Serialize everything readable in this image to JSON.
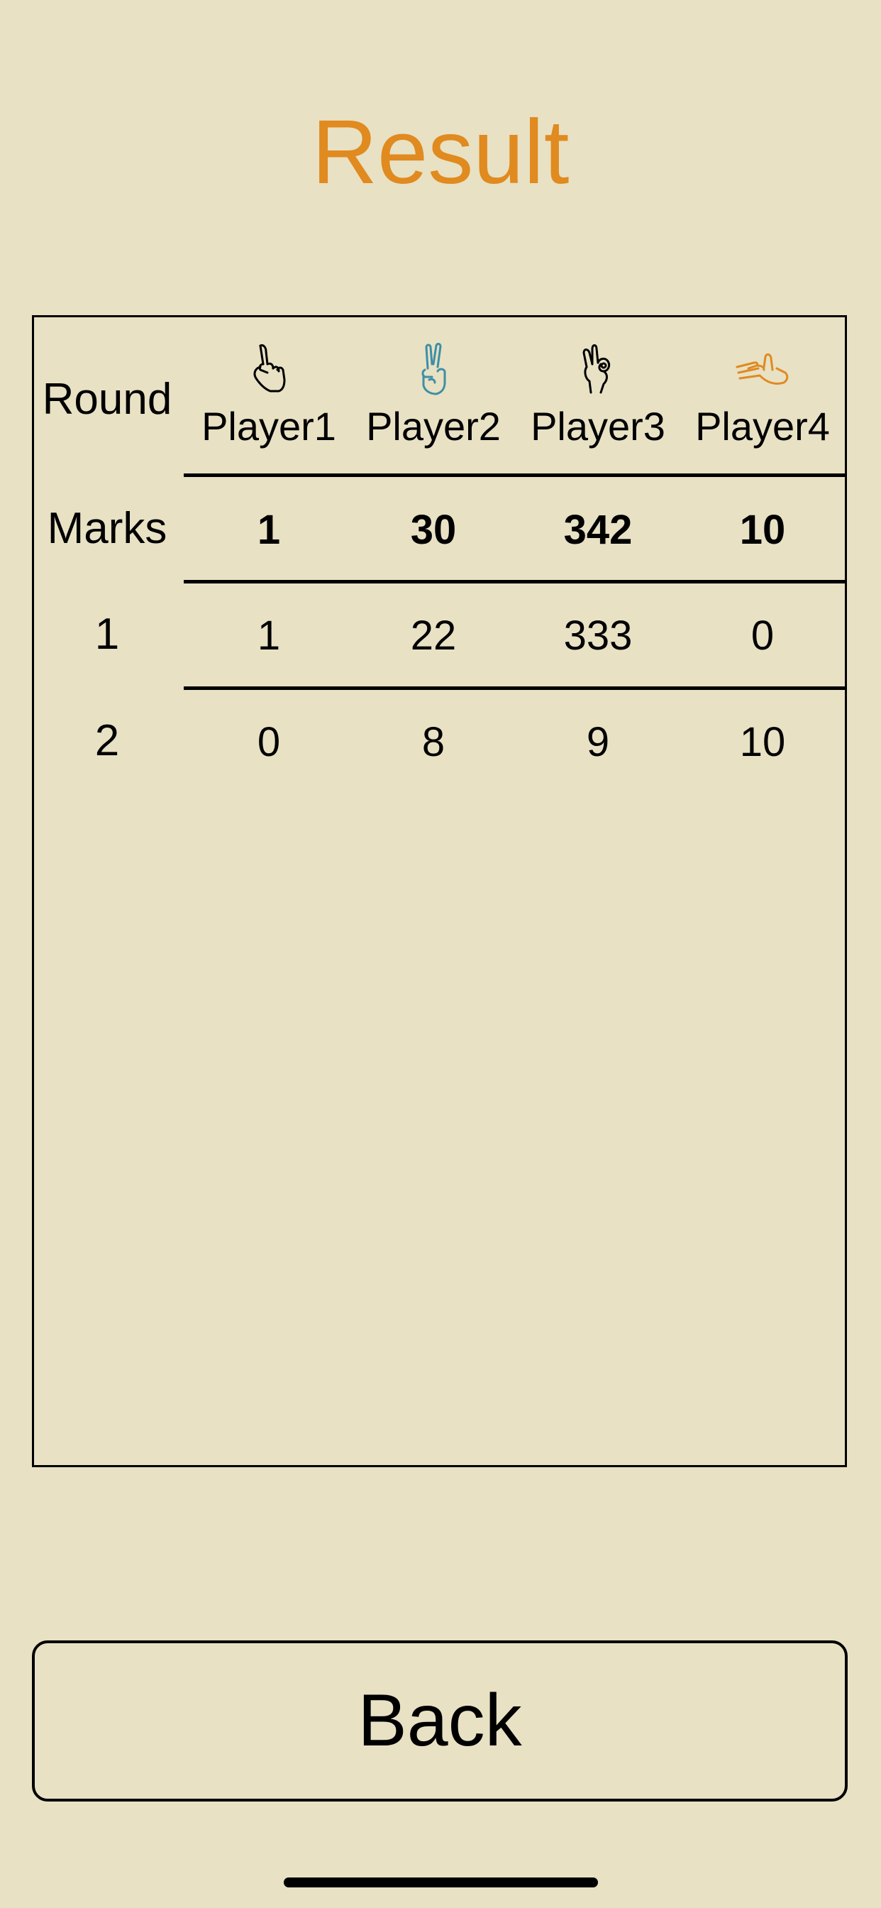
{
  "header": {
    "title": "Result"
  },
  "table": {
    "round_label": "Round",
    "players": [
      {
        "name": "Player1",
        "icon": "pointing-hand-icon",
        "color": "#000000"
      },
      {
        "name": "Player2",
        "icon": "victory-hand-icon",
        "color": "#3e8fa6"
      },
      {
        "name": "Player3",
        "icon": "ok-hand-icon",
        "color": "#000000"
      },
      {
        "name": "Player4",
        "icon": "open-hand-icon",
        "color": "#e08a1f"
      }
    ],
    "marks": {
      "label": "Marks",
      "values": [
        "1",
        "30",
        "342",
        "10"
      ]
    },
    "rounds": [
      {
        "label": "1",
        "values": [
          "1",
          "22",
          "333",
          "0"
        ]
      },
      {
        "label": "2",
        "values": [
          "0",
          "8",
          "9",
          "10"
        ]
      }
    ]
  },
  "footer": {
    "back_label": "Back"
  },
  "colors": {
    "background": "#e8e1c4",
    "accent": "#e08a1f",
    "player2_icon": "#3e8fa6"
  }
}
